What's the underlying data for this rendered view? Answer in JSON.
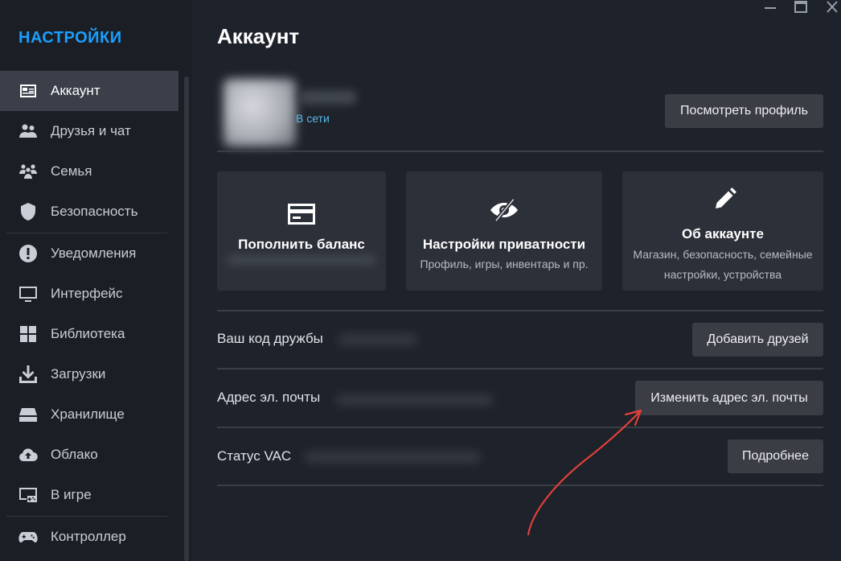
{
  "sidebar": {
    "title": "НАСТРОЙКИ",
    "items": [
      {
        "label": "Аккаунт",
        "icon": "account-card-icon"
      },
      {
        "label": "Друзья и чат",
        "icon": "friends-icon"
      },
      {
        "label": "Семья",
        "icon": "family-icon"
      },
      {
        "label": "Безопасность",
        "icon": "shield-icon"
      },
      {
        "label": "Уведомления",
        "icon": "alert-icon"
      },
      {
        "label": "Интерфейс",
        "icon": "monitor-icon"
      },
      {
        "label": "Библиотека",
        "icon": "grid-icon"
      },
      {
        "label": "Загрузки",
        "icon": "download-icon"
      },
      {
        "label": "Хранилище",
        "icon": "storage-icon"
      },
      {
        "label": "Облако",
        "icon": "cloud-icon"
      },
      {
        "label": "В игре",
        "icon": "in-game-icon"
      },
      {
        "label": "Контроллер",
        "icon": "controller-icon"
      }
    ]
  },
  "window": {
    "minimize_icon": "minimize-icon",
    "maximize_icon": "maximize-icon",
    "close_icon": "close-icon"
  },
  "main": {
    "title": "Аккаунт",
    "profile": {
      "status": "В сети",
      "view_profile_label": "Посмотреть профиль"
    },
    "cards": [
      {
        "title": "Пополнить баланс",
        "subtitle": "",
        "icon": "wallet-card-icon"
      },
      {
        "title": "Настройки приватности",
        "subtitle": "Профиль, игры, инвентарь и пр.",
        "icon": "eye-off-icon"
      },
      {
        "title": "Об аккаунте",
        "subtitle": "Магазин, безопасность, семейные настройки, устройства",
        "icon": "pencil-icon"
      }
    ],
    "rows": [
      {
        "label": "Ваш код дружбы",
        "button": "Добавить друзей"
      },
      {
        "label": "Адрес эл. почты",
        "button": "Изменить адрес эл. почты"
      },
      {
        "label": "Статус VAC",
        "button": "Подробнее"
      }
    ]
  },
  "colors": {
    "accent": "#1a9fff",
    "annotation_arrow": "#e0403a",
    "background": "#1e222a",
    "sidebar_bg": "#1b1e24"
  }
}
